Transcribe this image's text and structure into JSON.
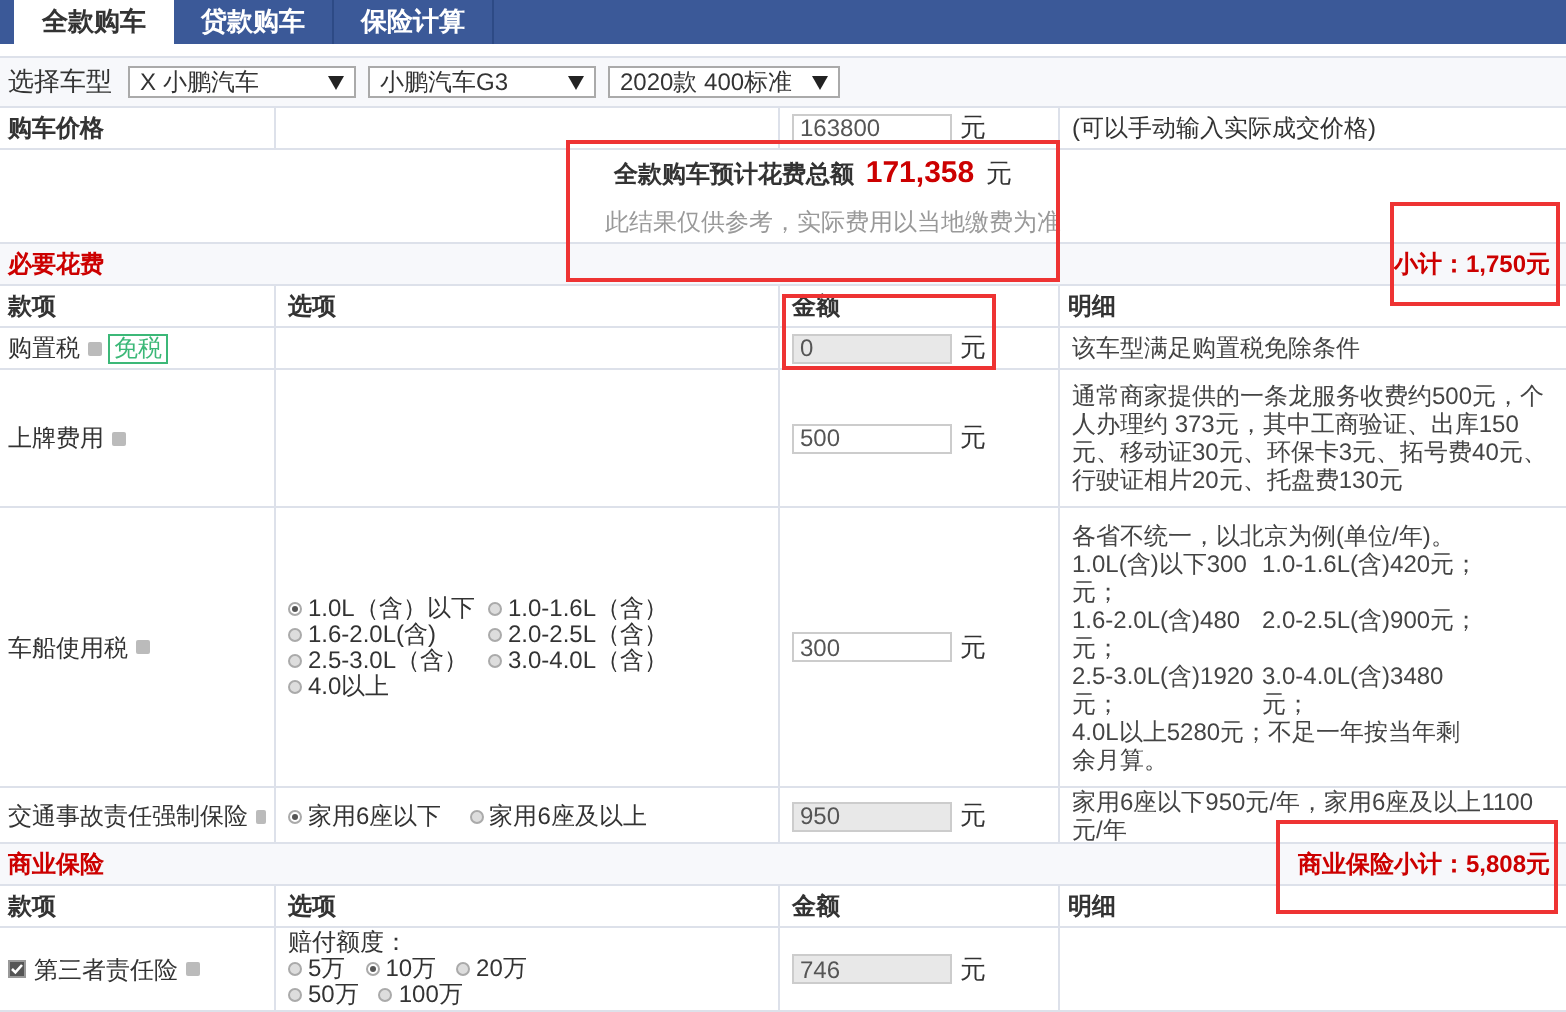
{
  "tabs": [
    {
      "label": "全款购车",
      "selected": true
    },
    {
      "label": "贷款购车",
      "selected": false
    },
    {
      "label": "保险计算",
      "selected": false
    }
  ],
  "selector": {
    "label": "选择车型",
    "dropdowns": [
      "X 小鹏汽车",
      "小鹏汽车G3",
      "2020款 400标准"
    ]
  },
  "price": {
    "label": "购车价格",
    "value": "163800",
    "unit": "元",
    "note": "(可以手动输入实际成交价格)"
  },
  "total": {
    "label": "全款购车预计花费总额",
    "amount": "171,358",
    "unit": "元",
    "disclaimer": "此结果仅供参考，实际费用以当地缴费为准"
  },
  "sections": [
    {
      "title": "必要花费",
      "subtotal": "小计：1,750元",
      "columns": [
        "款项",
        "选项",
        "金额",
        "明细"
      ],
      "rows": [
        {
          "name": "购置税",
          "badge": "免税",
          "value": "0",
          "readonly": true,
          "unit": "元",
          "detail": [
            "该车型满足购置税免除条件"
          ]
        },
        {
          "name": "上牌费用",
          "value": "500",
          "readonly": false,
          "unit": "元",
          "detail": [
            "通常商家提供的一条龙服务收费约500元，个人办理约 373元，其中工商验证、出库150元、移动证30元、环保卡3元、拓号费40元、行驶证相片20元、托盘费130元"
          ]
        },
        {
          "name": "车船使用税",
          "options": {
            "kind": "grid",
            "items": [
              {
                "label": "1.0L（含）以下",
                "selected": true
              },
              {
                "label": "1.0-1.6L（含）",
                "selected": false
              },
              {
                "label": "1.6-2.0L(含)",
                "selected": false
              },
              {
                "label": "2.0-2.5L（含）",
                "selected": false
              },
              {
                "label": "2.5-3.0L（含）",
                "selected": false
              },
              {
                "label": "3.0-4.0L（含）",
                "selected": false
              },
              {
                "label": "4.0以上",
                "selected": false
              }
            ]
          },
          "value": "300",
          "readonly": false,
          "unit": "元",
          "detail": [
            "各省不统一，以北京为例(单位/年)。"
          ],
          "detail_grid": [
            "1.0L(含)以下300元；",
            "1.0-1.6L(含)420元；",
            "1.6-2.0L(含)480元；",
            "2.0-2.5L(含)900元；",
            "2.5-3.0L(含)1920元；",
            "3.0-4.0L(含)3480元；"
          ],
          "detail_tail": "4.0L以上5280元；不足一年按当年剩余月算。"
        },
        {
          "name": "交通事故责任强制保险",
          "options": {
            "kind": "inline",
            "items": [
              {
                "label": "家用6座以下",
                "selected": true
              },
              {
                "label": "家用6座及以上",
                "selected": false
              }
            ]
          },
          "value": "950",
          "readonly": true,
          "unit": "元",
          "detail": [
            "家用6座以下950元/年，家用6座及以上1100元/年"
          ]
        }
      ]
    },
    {
      "title": "商业保险",
      "subtotal": "商业保险小计：5,808元",
      "columns": [
        "款项",
        "选项",
        "金额",
        "明细"
      ],
      "rows": [
        {
          "name": "第三者责任险",
          "checked": true,
          "options": {
            "caption": "赔付额度：",
            "kind": "wrap",
            "items": [
              {
                "label": "5万",
                "selected": false
              },
              {
                "label": "10万",
                "selected": true
              },
              {
                "label": "20万",
                "selected": false
              },
              {
                "label": "50万",
                "selected": false
              },
              {
                "label": "100万",
                "selected": false
              }
            ]
          },
          "value": "746",
          "readonly": true,
          "unit": "元",
          "detail": []
        }
      ]
    }
  ]
}
